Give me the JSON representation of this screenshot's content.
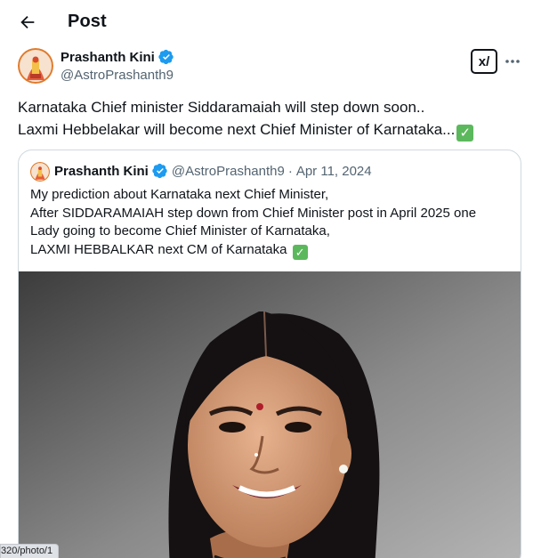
{
  "header": {
    "title": "Post",
    "back_icon": "arrow-left-icon"
  },
  "post": {
    "author_name": "Prashanth Kini",
    "author_handle": "@AstroPrashanth9",
    "verified": true,
    "grok_label": "x/",
    "more_label": "···",
    "text_lines": [
      "Karnataka Chief minister Siddaramaiah will step down soon..",
      "Laxmi Hebbelakar will become next Chief Minister of Karnataka..."
    ]
  },
  "quote": {
    "author_name": "Prashanth Kini",
    "author_handle": "@AstroPrashanth9",
    "separator": "·",
    "date": "Apr 11, 2024",
    "text_lines": [
      "My prediction about Karnataka next Chief Minister,",
      "After SIDDARAMAIAH step down from Chief Minister post in April 2025 one",
      "Lady going to become Chief Minister of Karnataka,",
      "LAXMI HEBBALKAR next CM of Karnataka"
    ]
  },
  "status_bar": {
    "url": "320/photo/1"
  },
  "colors": {
    "text": "#0f1419",
    "secondary": "#536471",
    "verified_blue": "#1d9bf0",
    "check_green": "#5cb85c",
    "border": "#cfd9de"
  }
}
